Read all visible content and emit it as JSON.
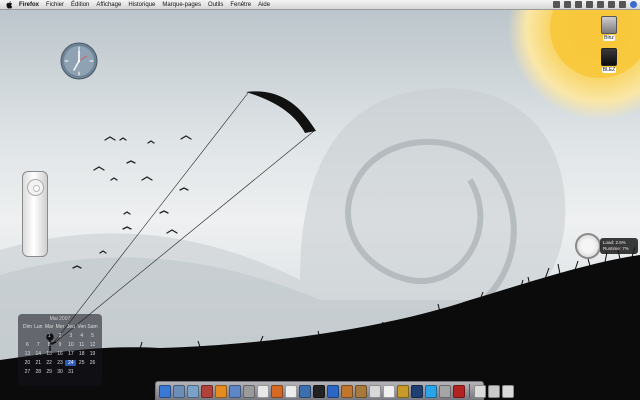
{
  "menubar": {
    "app_name": "Firefox",
    "items": [
      "Fichier",
      "Édition",
      "Affichage",
      "Historique",
      "Marque-pages",
      "Outils",
      "Fenêtre",
      "Aide"
    ]
  },
  "desktop": {
    "drives": [
      {
        "label": "Blnz",
        "icon": "hard-drive-icon"
      },
      {
        "label": "BLEZ",
        "icon": "black-drive-icon"
      }
    ]
  },
  "calendar": {
    "title": "Mai 2007",
    "weekdays": [
      "Dim",
      "Lun",
      "Mar",
      "Mer",
      "Jeu",
      "Ven",
      "Sam"
    ],
    "rows": [
      [
        "",
        "",
        "1",
        "2",
        "3",
        "4",
        "5"
      ],
      [
        "6",
        "7",
        "8",
        "9",
        "10",
        "11",
        "12"
      ],
      [
        "13",
        "14",
        "15",
        "16",
        "17",
        "18",
        "19"
      ],
      [
        "20",
        "21",
        "22",
        "23",
        "24",
        "25",
        "26"
      ],
      [
        "27",
        "28",
        "29",
        "30",
        "31",
        "",
        ""
      ]
    ],
    "today": "24"
  },
  "gauge": {
    "line1": "Load: 2.5%",
    "line2": "Runtime: 7%"
  },
  "dock": {
    "icons": [
      {
        "name": "finder-icon",
        "color": "#3a78d6"
      },
      {
        "name": "mail-icon",
        "color": "#6b8fb8"
      },
      {
        "name": "iphoto-icon",
        "color": "#7aa2c8"
      },
      {
        "name": "photobooth-icon",
        "color": "#b0423a"
      },
      {
        "name": "vlc-icon",
        "color": "#e58a1f"
      },
      {
        "name": "itunes-icon",
        "color": "#5e86c7"
      },
      {
        "name": "gear-icon",
        "color": "#9a9a9a"
      },
      {
        "name": "safari-icon",
        "color": "#e8e8e8"
      },
      {
        "name": "firefox-icon",
        "color": "#d46a26"
      },
      {
        "name": "ichat-icon",
        "color": "#ededed"
      },
      {
        "name": "aperture-icon",
        "color": "#3c6fb0"
      },
      {
        "name": "terminal-icon",
        "color": "#222222"
      },
      {
        "name": "quicktime-icon",
        "color": "#2c67c5"
      },
      {
        "name": "guitar-icon",
        "color": "#c0762f"
      },
      {
        "name": "address-book-icon",
        "color": "#a6793c"
      },
      {
        "name": "ical-icon",
        "color": "#d8d8d8"
      },
      {
        "name": "textedit-icon",
        "color": "#f0f0f0"
      },
      {
        "name": "wow-icon",
        "color": "#c79a2a"
      },
      {
        "name": "photoshop-icon",
        "color": "#1f3f73"
      },
      {
        "name": "skype-icon",
        "color": "#2ba3e6"
      },
      {
        "name": "itunes-store-icon",
        "color": "#a5a5a5"
      },
      {
        "name": "flash-icon",
        "color": "#b22222"
      },
      {
        "name": "documents-stack-icon",
        "color": "#dcdcdc"
      },
      {
        "name": "applications-stack-icon",
        "color": "#c9c9c9"
      },
      {
        "name": "trash-icon",
        "color": "#d9d9d9"
      }
    ]
  }
}
